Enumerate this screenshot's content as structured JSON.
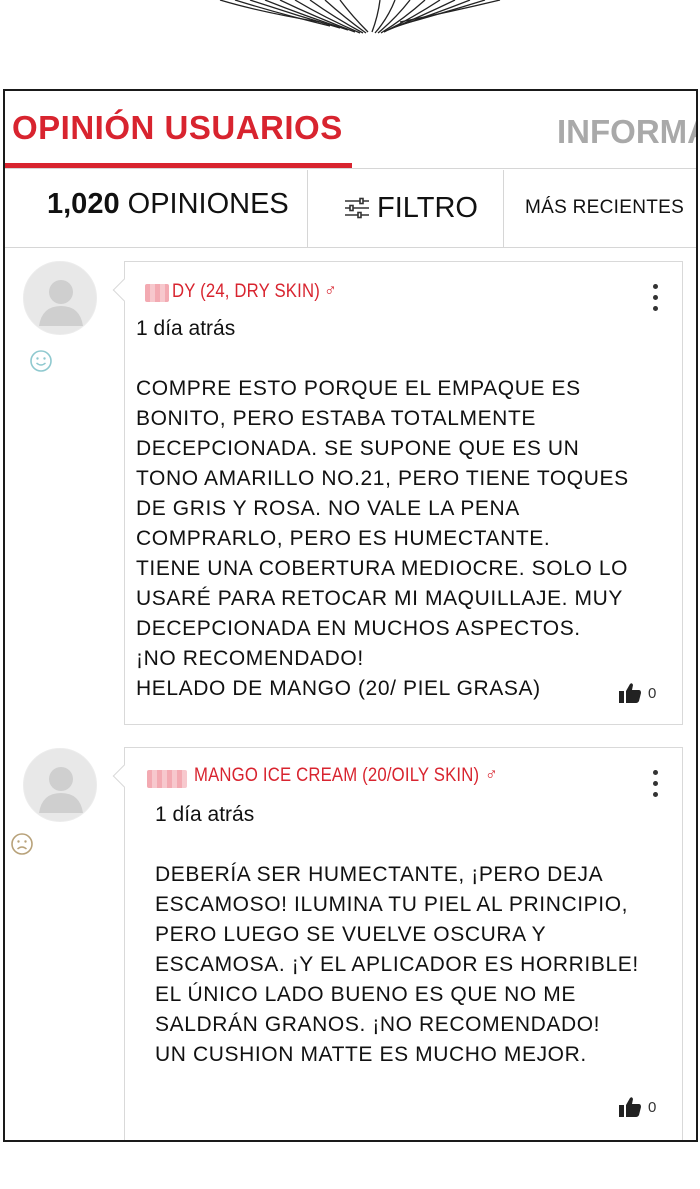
{
  "tabs": {
    "active": "OPINIÓN USUARIOS",
    "info": "INFORMA"
  },
  "toolbar": {
    "count_number": "1,020",
    "count_label": " OPINIONES",
    "filter_label": "FILTRO",
    "sort_label": "MÁS RECIENTES"
  },
  "reviews": [
    {
      "mood_icon": "smile-icon",
      "username": "DY (24, DRY SKIN)",
      "gender": "♂",
      "date": "1 día atrás",
      "lines": [
        "COMPRE ESTO PORQUE EL EMPAQUE ES",
        "BONITO, PERO ESTABA TOTALMENTE",
        "DECEPCIONADA. SE SUPONE QUE ES UN",
        "TONO AMARILLO NO.21, PERO TIENE TOQUES",
        "DE GRIS Y ROSA. NO VALE LA PENA",
        "COMPRARLO, PERO ES HUMECTANTE.",
        "TIENE UNA COBERTURA MEDIOCRE. SOLO LO",
        "USARÉ PARA RETOCAR MI MAQUILLAJE. MUY",
        "DECEPCIONADA EN MUCHOS ASPECTOS.",
        "¡NO RECOMENDADO!",
        "HELADO DE MANGO (20/ PIEL GRASA)"
      ],
      "likes": "0"
    },
    {
      "mood_icon": "frown-icon",
      "username": "MANGO ICE CREAM (20/OILY SKIN)",
      "gender": "♂",
      "date": "1 día atrás",
      "lines": [
        "DEBERÍA SER HUMECTANTE, ¡PERO DEJA",
        "ESCAMOSO! ILUMINA TU PIEL AL PRINCIPIO,",
        "PERO LUEGO SE VUELVE OSCURA Y",
        "ESCAMOSA. ¡Y EL APLICADOR ES HORRIBLE!",
        "EL ÚNICO LADO BUENO ES QUE NO ME",
        "SALDRÁN GRANOS. ¡NO RECOMENDADO!",
        "UN CUSHION MATTE ES MUCHO MEJOR."
      ],
      "likes": "0"
    }
  ],
  "colors": {
    "accent": "#d8242f",
    "inactive_tab": "#a9a9a9",
    "divider": "#d6d6d6",
    "smile_icon": "#8fc9cf",
    "frown_icon": "#b8a27a"
  }
}
